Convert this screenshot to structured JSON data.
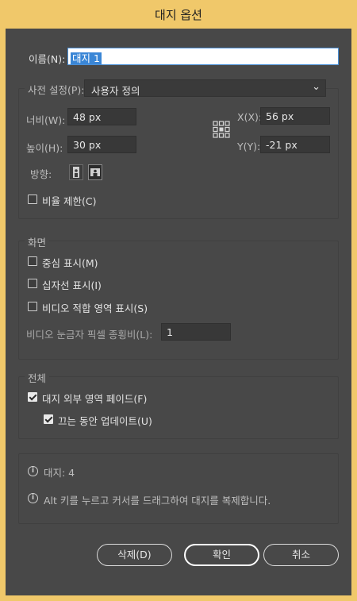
{
  "window": {
    "title": "대지 옵션"
  },
  "name": {
    "label": "이름(N):",
    "value": "대지 1"
  },
  "preset": {
    "label": "사전 설정(P):",
    "value": "사용자 정의"
  },
  "size": {
    "width_label": "너비(W):",
    "width_value": "48 px",
    "height_label": "높이(H):",
    "height_value": "30 px",
    "x_label": "X(X):",
    "x_value": "56 px",
    "y_label": "Y(Y):",
    "y_value": "-21 px",
    "orientation_label": "방향:",
    "constrain_label": "비율 제한(C)"
  },
  "display": {
    "title": "화면",
    "center_mark": "중심 표시(M)",
    "cross_hairs": "십자선 표시(I)",
    "video_safe": "비디오 적합 영역 표시(S)",
    "pixel_aspect_label": "비디오 눈금자 픽셀 종횡비(L):",
    "pixel_aspect_value": "1"
  },
  "global": {
    "title": "전체",
    "fade_region": "대지 외부 영역 페이드(F)",
    "update_drag": "끄는 동안 업데이트(U)"
  },
  "info": {
    "count": "대지: 4",
    "hint": "Alt 키를 누르고 커서를 드래그하여 대지를 복제합니다."
  },
  "buttons": {
    "delete": "삭제(D)",
    "ok": "확인",
    "cancel": "취소"
  },
  "state": {
    "constrain_checked": false,
    "center_mark_checked": false,
    "cross_hairs_checked": false,
    "video_safe_checked": false,
    "fade_region_checked": true,
    "update_drag_checked": true,
    "orientation_selected": "landscape"
  }
}
